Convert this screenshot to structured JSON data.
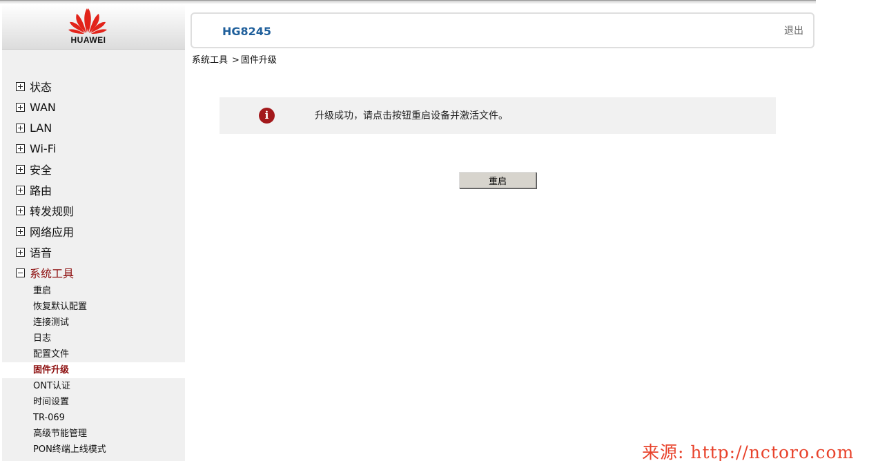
{
  "brand": {
    "logo_text": "HUAWEI",
    "logo_color": "#e2231a"
  },
  "header": {
    "model": "HG8245",
    "logout": "退出"
  },
  "breadcrumb": {
    "section": "系统工具",
    "separator": ">",
    "page": "固件升级"
  },
  "menu": {
    "items": [
      {
        "label": "状态",
        "expanded": false
      },
      {
        "label": "WAN",
        "expanded": false
      },
      {
        "label": "LAN",
        "expanded": false
      },
      {
        "label": "Wi-Fi",
        "expanded": false
      },
      {
        "label": "安全",
        "expanded": false
      },
      {
        "label": "路由",
        "expanded": false
      },
      {
        "label": "转发规则",
        "expanded": false
      },
      {
        "label": "网络应用",
        "expanded": false
      },
      {
        "label": "语音",
        "expanded": false
      },
      {
        "label": "系统工具",
        "expanded": true
      }
    ],
    "submenu": [
      {
        "label": "重启"
      },
      {
        "label": "恢复默认配置"
      },
      {
        "label": "连接测试"
      },
      {
        "label": "日志"
      },
      {
        "label": "配置文件"
      },
      {
        "label": "固件升级",
        "active": true
      },
      {
        "label": "ONT认证"
      },
      {
        "label": "时间设置"
      },
      {
        "label": "TR-069"
      },
      {
        "label": "高级节能管理"
      },
      {
        "label": "PON终端上线模式"
      }
    ]
  },
  "message": {
    "icon": "info-icon",
    "text": "升级成功，请点击按钮重启设备并激活文件。"
  },
  "actions": {
    "reboot_label": "重启"
  },
  "watermark": "来源: http://nctoro.com",
  "colors": {
    "accent_red": "#8b0a0a",
    "model_blue": "#1f5f9b",
    "info_red": "#a3191c"
  }
}
